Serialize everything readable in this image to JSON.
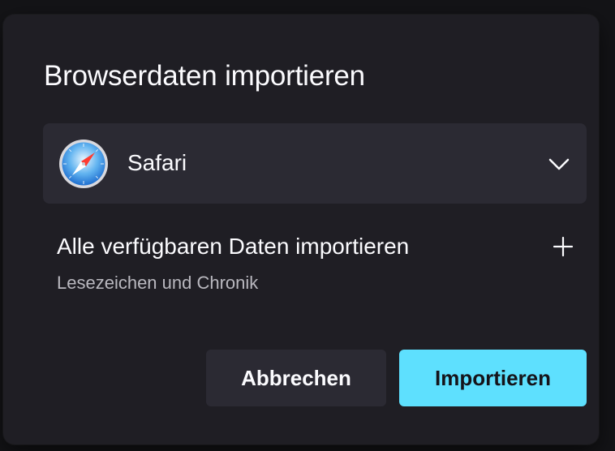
{
  "dialog": {
    "title": "Browserdaten importieren",
    "browser_select": {
      "selected": "Safari",
      "icon": "safari-compass-icon"
    },
    "import_option": {
      "title": "Alle verfügbaren Daten importieren",
      "subtitle": "Lesezeichen und Chronik",
      "expand_icon": "plus-icon"
    },
    "buttons": {
      "cancel": "Abbrechen",
      "import": "Importieren"
    }
  },
  "colors": {
    "dialog_bg": "#1f1e24",
    "field_bg": "#2b2a33",
    "accent": "#5ee0fe",
    "text_primary": "#fbfbfe",
    "text_secondary": "#b9b8bf"
  }
}
